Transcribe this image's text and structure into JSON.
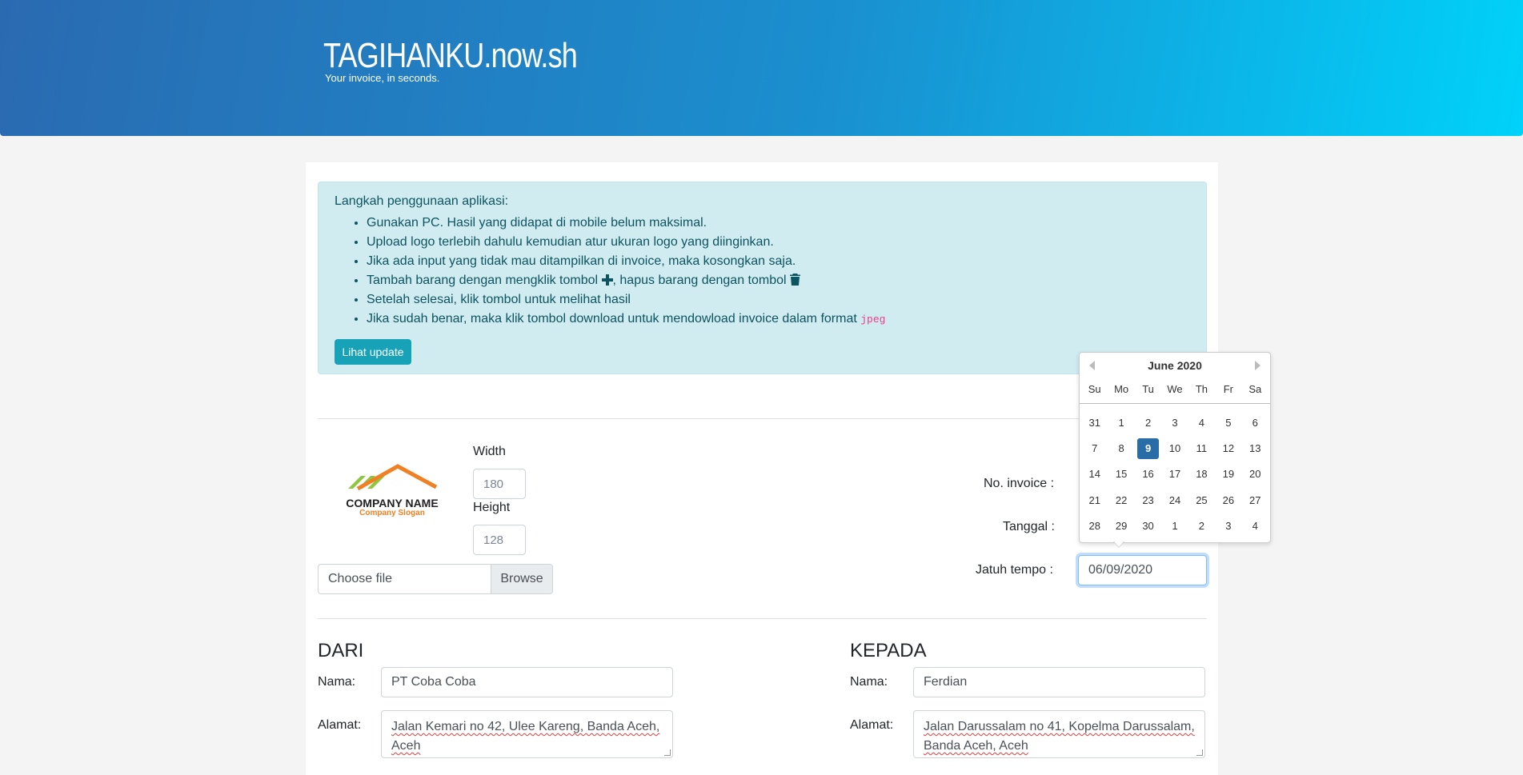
{
  "header": {
    "title": "TAGIHANKU.now.sh",
    "subtitle": "Your invoice, in seconds."
  },
  "alert": {
    "intro": "Langkah penggunaan aplikasi:",
    "items": [
      "Gunakan PC. Hasil yang didapat di mobile belum maksimal.",
      "Upload logo terlebih dahulu kemudian atur ukuran logo yang diinginkan.",
      "Jika ada input yang tidak mau ditampilkan di invoice, maka kosongkan saja."
    ],
    "item4_a": "Tambah barang dengan mengklik tombol ",
    "item4_b": ", hapus barang dengan tombol ",
    "item5": "Setelah selesai, klik tombol untuk melihat hasil",
    "item6_a": "Jika sudah benar, maka klik tombol download untuk mendowload invoice dalam format ",
    "item6_code": "jpeg",
    "update_button": "Lihat update"
  },
  "logo": {
    "company_name": "COMPANY NAME",
    "slogan": "Company Slogan",
    "width_label": "Width",
    "width_value": "180",
    "height_label": "Height",
    "height_value": "128",
    "file_placeholder": "Choose file",
    "browse_label": "Browse"
  },
  "invoice": {
    "no_label": "No. invoice :",
    "date_label": "Tanggal :",
    "due_label": "Jatuh tempo :",
    "due_value": "06/09/2020"
  },
  "datepicker": {
    "month": "June 2020",
    "weekdays": [
      "Su",
      "Mo",
      "Tu",
      "We",
      "Th",
      "Fr",
      "Sa"
    ],
    "days": [
      "31",
      "1",
      "2",
      "3",
      "4",
      "5",
      "6",
      "7",
      "8",
      "9",
      "10",
      "11",
      "12",
      "13",
      "14",
      "15",
      "16",
      "17",
      "18",
      "19",
      "20",
      "21",
      "22",
      "23",
      "24",
      "25",
      "26",
      "27",
      "28",
      "29",
      "30",
      "1",
      "2",
      "3",
      "4"
    ],
    "selected": "9"
  },
  "from": {
    "heading": "DARI",
    "name_label": "Nama:",
    "name_value": "PT Coba Coba",
    "address_label": "Alamat:",
    "address_value": "Jalan Kemari no 42, Ulee Kareng, Banda Aceh, Aceh"
  },
  "to": {
    "heading": "KEPADA",
    "name_label": "Nama:",
    "name_value": "Ferdian",
    "address_label": "Alamat:",
    "address_value": "Jalan Darussalam no 41, Kopelma Darussalam, Banda Aceh, Aceh"
  },
  "colors": {
    "header_start": "#2a6ab1",
    "header_end": "#00d2fa",
    "info_button": "#17a2b8",
    "selected_day": "#286ca8"
  }
}
